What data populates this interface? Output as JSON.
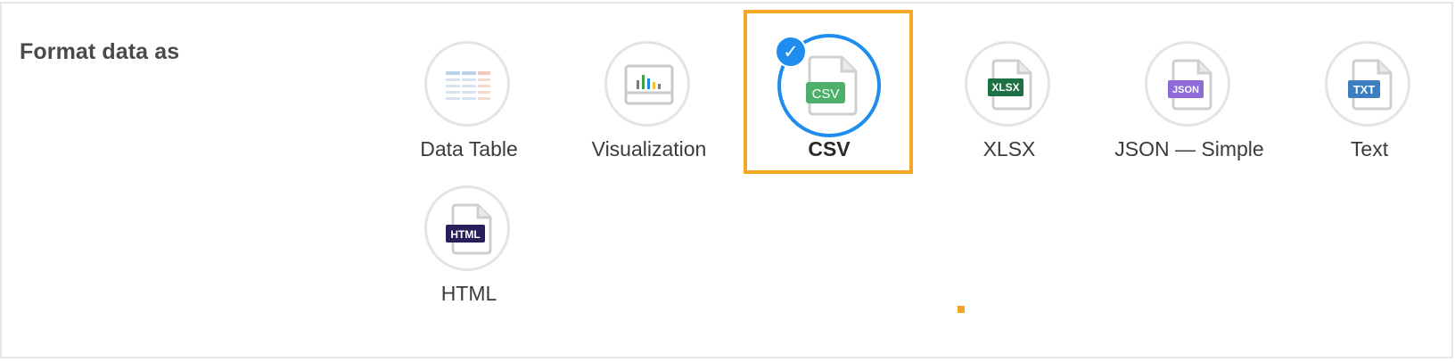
{
  "section": {
    "label": "Format data as"
  },
  "options": [
    {
      "label": "Data Table",
      "icon": "data-table-icon",
      "selected": false
    },
    {
      "label": "Visualization",
      "icon": "visualization-icon",
      "selected": false
    },
    {
      "label": "CSV",
      "badge": "CSV",
      "badge_color": "#4caf6a",
      "icon": "csv-file-icon",
      "selected": true
    },
    {
      "label": "XLSX",
      "badge": "XLSX",
      "badge_color": "#1e7145",
      "icon": "xlsx-file-icon",
      "selected": false
    },
    {
      "label": "JSON — Simple",
      "badge": "JSON",
      "badge_color": "#8e6bd6",
      "icon": "json-file-icon",
      "selected": false
    },
    {
      "label": "Text",
      "badge": "TXT",
      "badge_color": "#3b7fc1",
      "icon": "txt-file-icon",
      "selected": false
    },
    {
      "label": "HTML",
      "badge": "HTML",
      "badge_color": "#2a1f5a",
      "icon": "html-file-icon",
      "selected": false
    }
  ],
  "colors": {
    "selected_ring": "#1f8cef",
    "highlight": "#f5a623",
    "ring": "#e4e4e4"
  }
}
